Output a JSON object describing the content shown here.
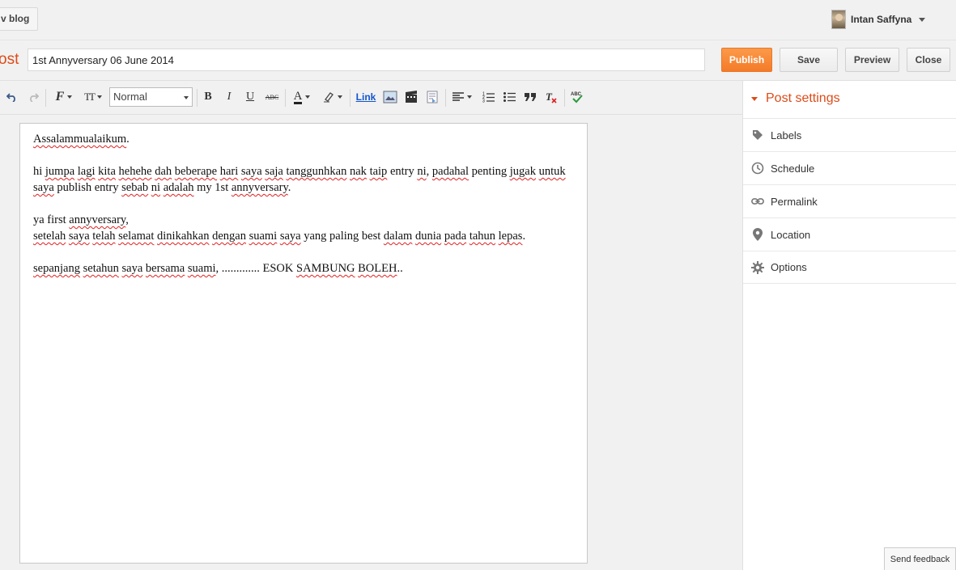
{
  "header": {
    "view_blog_label": "v blog",
    "user_name": "Intan Saffyna"
  },
  "title_row": {
    "post_label": "ost",
    "title_value": "1st Annyversary 06 June 2014",
    "publish_label": "Publish",
    "save_label": "Save",
    "preview_label": "Preview",
    "close_label": "Close"
  },
  "toolbar": {
    "format_value": "Normal",
    "link_label": "Link",
    "font_glyph": "F",
    "size_glyph": "TT",
    "bold_glyph": "B",
    "italic_glyph": "I",
    "underline_glyph": "U",
    "strike_glyph": "ABC",
    "text_color_glyph": "A"
  },
  "editor": {
    "paragraphs": [
      [
        {
          "t": "Assalammualaikum",
          "s": true
        },
        {
          "t": ".",
          "s": false
        }
      ],
      [],
      [
        {
          "t": "hi ",
          "s": false
        },
        {
          "t": "jumpa",
          "s": true
        },
        {
          "t": " ",
          "s": false
        },
        {
          "t": "lagi",
          "s": true
        },
        {
          "t": " ",
          "s": false
        },
        {
          "t": "kita",
          "s": true
        },
        {
          "t": " ",
          "s": false
        },
        {
          "t": "hehehe",
          "s": true
        },
        {
          "t": " ",
          "s": false
        },
        {
          "t": "dah",
          "s": true
        },
        {
          "t": " ",
          "s": false
        },
        {
          "t": "beberape",
          "s": true
        },
        {
          "t": " ",
          "s": false
        },
        {
          "t": "hari",
          "s": true
        },
        {
          "t": " ",
          "s": false
        },
        {
          "t": "saya",
          "s": true
        },
        {
          "t": " ",
          "s": false
        },
        {
          "t": "saja",
          "s": true
        },
        {
          "t": " ",
          "s": false
        },
        {
          "t": "tanggunhkan",
          "s": true
        },
        {
          "t": " ",
          "s": false
        },
        {
          "t": "nak",
          "s": true
        },
        {
          "t": " ",
          "s": false
        },
        {
          "t": "taip",
          "s": true
        },
        {
          "t": " entry ",
          "s": false
        },
        {
          "t": "ni",
          "s": true
        },
        {
          "t": ", ",
          "s": false
        },
        {
          "t": "padahal",
          "s": true
        },
        {
          "t": " penting ",
          "s": false
        },
        {
          "t": "jugak",
          "s": true
        },
        {
          "t": " ",
          "s": false
        },
        {
          "t": "untuk",
          "s": true
        },
        {
          "t": " ",
          "s": false
        },
        {
          "t": "saya",
          "s": true
        },
        {
          "t": " publish entry ",
          "s": false
        },
        {
          "t": "sebab",
          "s": true
        },
        {
          "t": " ",
          "s": false
        },
        {
          "t": "ni",
          "s": true
        },
        {
          "t": " ",
          "s": false
        },
        {
          "t": "adalah",
          "s": true
        },
        {
          "t": " my 1st ",
          "s": false
        },
        {
          "t": "annyversary",
          "s": true
        },
        {
          "t": ".",
          "s": false
        }
      ],
      [],
      [
        {
          "t": "ya first ",
          "s": false
        },
        {
          "t": "annyversary",
          "s": true
        },
        {
          "t": ",",
          "s": false
        }
      ],
      [
        {
          "t": "setelah",
          "s": true
        },
        {
          "t": " ",
          "s": false
        },
        {
          "t": "saya",
          "s": true
        },
        {
          "t": " ",
          "s": false
        },
        {
          "t": "telah",
          "s": true
        },
        {
          "t": " ",
          "s": false
        },
        {
          "t": "selamat",
          "s": true
        },
        {
          "t": " ",
          "s": false
        },
        {
          "t": "dinikahkan",
          "s": true
        },
        {
          "t": " ",
          "s": false
        },
        {
          "t": "dengan",
          "s": true
        },
        {
          "t": " ",
          "s": false
        },
        {
          "t": "suami",
          "s": true
        },
        {
          "t": " ",
          "s": false
        },
        {
          "t": "saya",
          "s": true
        },
        {
          "t": " yang paling best ",
          "s": false
        },
        {
          "t": "dalam",
          "s": true
        },
        {
          "t": " ",
          "s": false
        },
        {
          "t": "dunia",
          "s": true
        },
        {
          "t": " ",
          "s": false
        },
        {
          "t": "pada",
          "s": true
        },
        {
          "t": " ",
          "s": false
        },
        {
          "t": "tahun",
          "s": true
        },
        {
          "t": " ",
          "s": false
        },
        {
          "t": "lepas",
          "s": true
        },
        {
          "t": ".",
          "s": false
        }
      ],
      [],
      [
        {
          "t": "sepanjang",
          "s": true
        },
        {
          "t": " ",
          "s": false
        },
        {
          "t": "setahun",
          "s": true
        },
        {
          "t": " ",
          "s": false
        },
        {
          "t": "saya",
          "s": true
        },
        {
          "t": " ",
          "s": false
        },
        {
          "t": "bersama",
          "s": true
        },
        {
          "t": " ",
          "s": false
        },
        {
          "t": "suami",
          "s": true
        },
        {
          "t": ", ............. ESOK ",
          "s": false
        },
        {
          "t": "SAMBUNG",
          "s": true
        },
        {
          "t": " ",
          "s": false
        },
        {
          "t": "BOLEH",
          "s": true
        },
        {
          "t": "..",
          "s": false
        }
      ]
    ]
  },
  "sidebar": {
    "header": "Post settings",
    "items": [
      {
        "label": "Labels",
        "icon": "tag-icon"
      },
      {
        "label": "Schedule",
        "icon": "clock-icon"
      },
      {
        "label": "Permalink",
        "icon": "link-icon"
      },
      {
        "label": "Location",
        "icon": "location-pin-icon"
      },
      {
        "label": "Options",
        "icon": "gear-icon"
      }
    ]
  },
  "footer": {
    "feedback_label": "Send feedback"
  },
  "colors": {
    "accent": "#dd4b1a",
    "publish": "#f47b28"
  }
}
